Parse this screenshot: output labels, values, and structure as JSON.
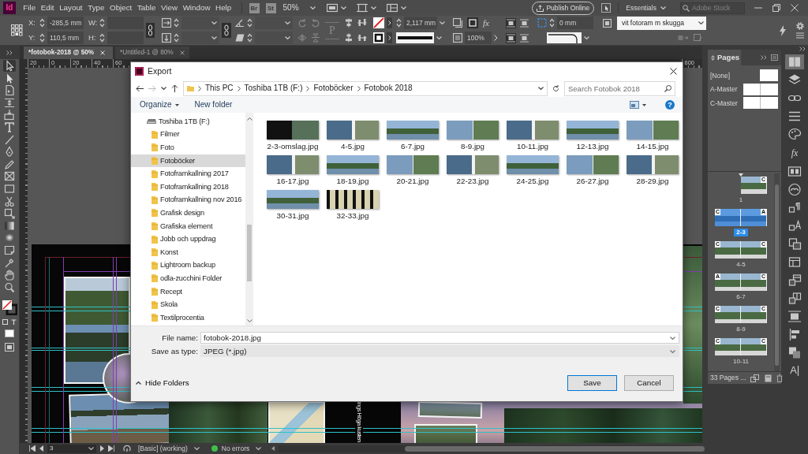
{
  "menu_bar": {
    "logo": "Id",
    "menus": [
      "File",
      "Edit",
      "Layout",
      "Type",
      "Object",
      "Table",
      "View",
      "Window",
      "Help"
    ],
    "bridge": "Br",
    "stock": "St",
    "zoom": "50%",
    "publish": "Publish Online",
    "workspace": "Essentials",
    "search": {
      "placeholder": "Adobe Stock"
    }
  },
  "control_bar": {
    "position": [
      {
        "label": "X:",
        "value": "-285,5 mm"
      },
      {
        "label": "Y:",
        "value": "110,5 mm"
      }
    ],
    "size": [
      {
        "label": "W:"
      },
      {
        "label": "H:"
      }
    ],
    "paragraph": "P",
    "stroke_weight": "2,117 mm",
    "effects": "fx",
    "opacity": "100%",
    "corner_size": "0 mm",
    "object_style": "vit fotoram m skugga"
  },
  "document_tabs": [
    {
      "label": "*fotobok-2018 @ 50%",
      "selected": true
    },
    {
      "label": "*Untitled-1 @ 80%",
      "selected": false
    }
  ],
  "tools": [
    {
      "kind": "selection",
      "selected": true
    },
    {
      "kind": "direct",
      "selected": false
    },
    {
      "kind": "page",
      "selected": false
    },
    {
      "kind": "gap",
      "selected": false
    },
    {
      "kind": "collector",
      "selected": false
    },
    {
      "kind": "type",
      "selected": false
    },
    {
      "kind": "line",
      "selected": false
    },
    {
      "kind": "pen",
      "selected": false
    },
    {
      "kind": "pencil",
      "selected": false
    },
    {
      "kind": "frame",
      "selected": false
    },
    {
      "kind": "rectangle",
      "selected": false
    },
    {
      "kind": "scissors",
      "selected": false
    },
    {
      "kind": "transform",
      "selected": false
    },
    {
      "kind": "gradient",
      "selected": false
    },
    {
      "kind": "feather",
      "selected": false
    },
    {
      "kind": "note",
      "selected": false
    },
    {
      "kind": "eyedropper",
      "selected": false
    },
    {
      "kind": "hand",
      "selected": false
    },
    {
      "kind": "zoom",
      "selected": false
    }
  ],
  "ruler": {
    "left_labels": [
      "20",
      "0",
      "20",
      "40",
      "60"
    ],
    "right_labels": [
      "600"
    ]
  },
  "canvas": {
    "vertical_text": "ings Höga kusten"
  },
  "dialog": {
    "title": "Export",
    "navigation": [
      {
        "kind": "back",
        "disabled": false
      },
      {
        "kind": "forward",
        "disabled": true
      }
    ],
    "path": [
      "This PC",
      "Toshiba 1TB (F:)",
      "Fotoböcker",
      "Fotobok 2018"
    ],
    "search": {
      "placeholder": "Search Fotobok 2018"
    },
    "organize": "Organize",
    "new_folder": "New folder",
    "help": "?",
    "tree": {
      "label": "Toshiba 1TB (F:)",
      "selected": false,
      "children": [
        {
          "label": "Filmer",
          "selected": false
        },
        {
          "label": "Foto",
          "selected": false
        },
        {
          "label": "Fotoböcker",
          "selected": true
        },
        {
          "label": "Fotoframkallning 2017",
          "selected": false
        },
        {
          "label": "Fotoframkallning 2018",
          "selected": false
        },
        {
          "label": "Fotoframkallning nov 2016",
          "selected": false
        },
        {
          "label": "Grafisk design",
          "selected": false
        },
        {
          "label": "Grafiska element",
          "selected": false
        },
        {
          "label": "Jobb och uppdrag",
          "selected": false
        },
        {
          "label": "Konst",
          "selected": false
        },
        {
          "label": "Lightroom backup",
          "selected": false
        },
        {
          "label": "odla-zucchini Folder",
          "selected": false
        },
        {
          "label": "Recept",
          "selected": false
        },
        {
          "label": "Skola",
          "selected": false
        },
        {
          "label": "Textilprocentia",
          "selected": false
        }
      ]
    },
    "files": [
      {
        "name": "2-3-omslag.jpg"
      },
      {
        "name": "4-5.jpg"
      },
      {
        "name": "6-7.jpg"
      },
      {
        "name": "8-9.jpg"
      },
      {
        "name": "10-11.jpg"
      },
      {
        "name": "12-13.jpg"
      },
      {
        "name": "14-15.jpg"
      },
      {
        "name": "16-17.jpg"
      },
      {
        "name": "18-19.jpg"
      },
      {
        "name": "20-21.jpg"
      },
      {
        "name": "22-23.jpg"
      },
      {
        "name": "24-25.jpg"
      },
      {
        "name": "26-27.jpg"
      },
      {
        "name": "28-29.jpg"
      },
      {
        "name": "30-31.jpg"
      },
      {
        "name": "32-33.jpg"
      }
    ],
    "file_name": {
      "label": "File name:",
      "value": "fotobok-2018.jpg"
    },
    "save_type": {
      "label": "Save as type:",
      "value": "JPEG (*.jpg)"
    },
    "hide_folders": "Hide Folders",
    "save": "Save",
    "cancel": "Cancel"
  },
  "pages_panel": {
    "title": "Pages",
    "masters": [
      {
        "name": "[None]",
        "kind": "single"
      },
      {
        "name": "A-Master",
        "kind": "spread"
      },
      {
        "name": "C-Master",
        "kind": "spread"
      }
    ],
    "spreads": [
      {
        "label": "1",
        "selected": false,
        "section_start": true,
        "pages": [
          {
            "master": "C"
          }
        ]
      },
      {
        "label": "2-3",
        "selected": true,
        "section_start": false,
        "pages": [
          {
            "master": "C"
          },
          {
            "master": "A"
          }
        ]
      },
      {
        "label": "4-5",
        "selected": false,
        "section_start": false,
        "pages": [
          {
            "master": "C"
          },
          {
            "master": "C"
          }
        ]
      },
      {
        "label": "6-7",
        "selected": false,
        "section_start": false,
        "pages": [
          {
            "master": "A"
          },
          {
            "master": "C"
          }
        ]
      },
      {
        "label": "8-9",
        "selected": false,
        "section_start": false,
        "pages": [
          {
            "master": "C"
          },
          {
            "master": "C"
          }
        ]
      },
      {
        "label": "10-11",
        "selected": false,
        "section_start": false,
        "pages": [
          {
            "master": "C"
          },
          {
            "master": "C"
          }
        ]
      }
    ],
    "footer": "33 Pages ..."
  },
  "dock": [
    {
      "kind": "pages",
      "selected": true
    },
    {
      "kind": "layers",
      "selected": false
    },
    {
      "kind": "links",
      "selected": false
    },
    {
      "kind": "stroke",
      "selected": false
    },
    {
      "kind": "color",
      "selected": false
    },
    {
      "kind": "effects",
      "selected": false,
      "glyph": "fx"
    },
    {
      "kind": "swatches",
      "selected": false
    },
    {
      "kind": "libraries",
      "selected": false
    },
    {
      "kind": "paragraph_styles",
      "selected": false
    },
    {
      "kind": "character_styles",
      "selected": false
    },
    {
      "kind": "object_styles",
      "selected": false
    },
    {
      "kind": "table",
      "selected": false
    },
    {
      "kind": "table_styles",
      "selected": false
    },
    {
      "kind": "cell_styles",
      "selected": false
    },
    {
      "kind": "wrap",
      "selected": false
    },
    {
      "kind": "align",
      "selected": false
    },
    {
      "kind": "pathfinder",
      "selected": false
    },
    {
      "kind": "character",
      "selected": false,
      "glyph": "A"
    }
  ],
  "status_bar": {
    "page": "3",
    "style": "[Basic] (working)",
    "preflight": "No errors"
  }
}
